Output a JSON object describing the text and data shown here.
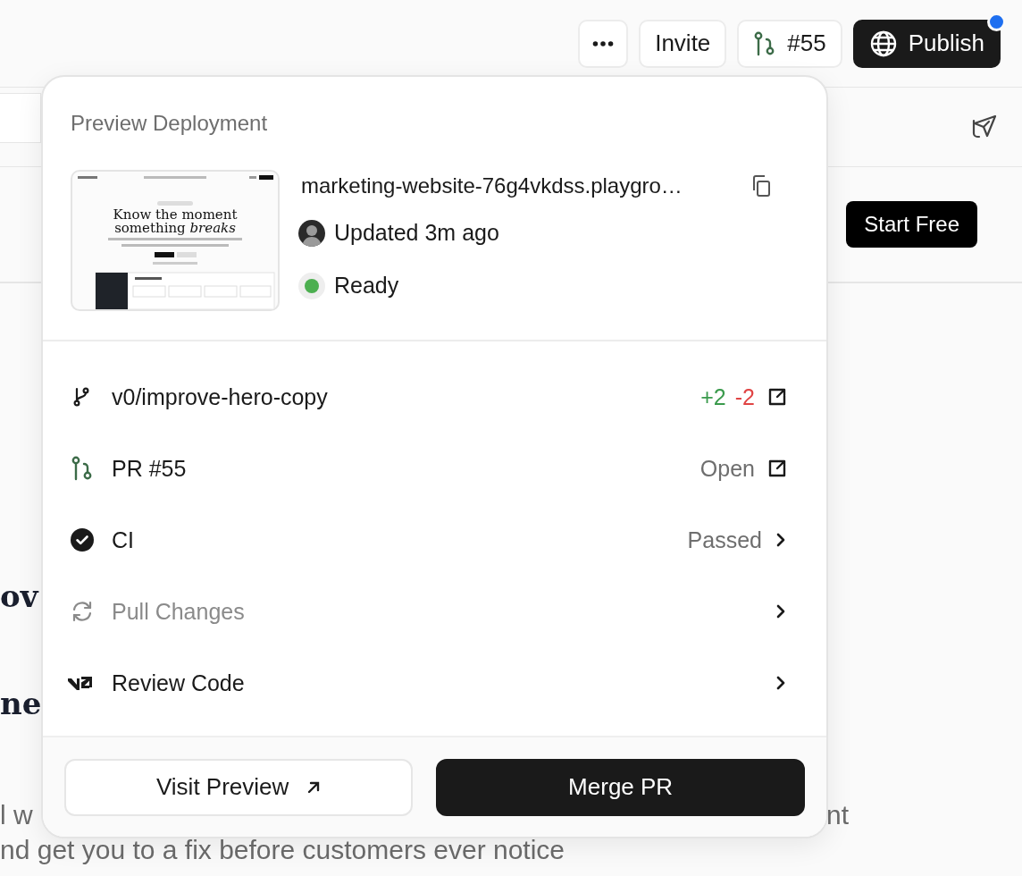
{
  "topbar": {
    "invite_button": {
      "label": "Invite"
    },
    "pr_button": {
      "label": "#55"
    },
    "publish_button": {
      "label": "Publish",
      "notification": true
    }
  },
  "page_header": {
    "cta_button": {
      "label": "Start Free"
    }
  },
  "hero": {
    "heading_lines": [
      "ov",
      "ne"
    ],
    "paragraph_line_1": {
      "left": "l w",
      "right": "nt"
    },
    "paragraph_line_2": "nd get you to a fix before customers ever notice"
  },
  "popover": {
    "title": "Preview Deployment",
    "preview": {
      "thumbnail": {
        "headline_1": "Know the moment",
        "headline_2": "something *breaks*"
      },
      "url": "marketing-website-76g4vkdss.playgro…",
      "updated": "Updated 3m ago",
      "status": {
        "label": "Ready",
        "color": "#4caf50"
      }
    },
    "rows": [
      {
        "kind": "branch",
        "label": "v0/improve-hero-copy",
        "additions": "+2",
        "deletions": "-2",
        "action": {
          "kind": "external"
        },
        "disabled": false
      },
      {
        "kind": "pr",
        "label": "PR #55",
        "status": "Open",
        "action": {
          "kind": "external"
        },
        "disabled": false
      },
      {
        "kind": "check",
        "label": "CI",
        "status": "Passed",
        "action": {
          "kind": "chevron"
        },
        "disabled": false
      },
      {
        "kind": "sync",
        "label": "Pull Changes",
        "action": {
          "kind": "chevron"
        },
        "disabled": true
      },
      {
        "kind": "logo",
        "label": "Review Code",
        "action": {
          "kind": "chevron"
        },
        "disabled": false
      }
    ],
    "buttons": [
      {
        "label": "Visit Preview",
        "kind": "secondary"
      },
      {
        "label": "Merge PR",
        "kind": "primary"
      }
    ]
  }
}
